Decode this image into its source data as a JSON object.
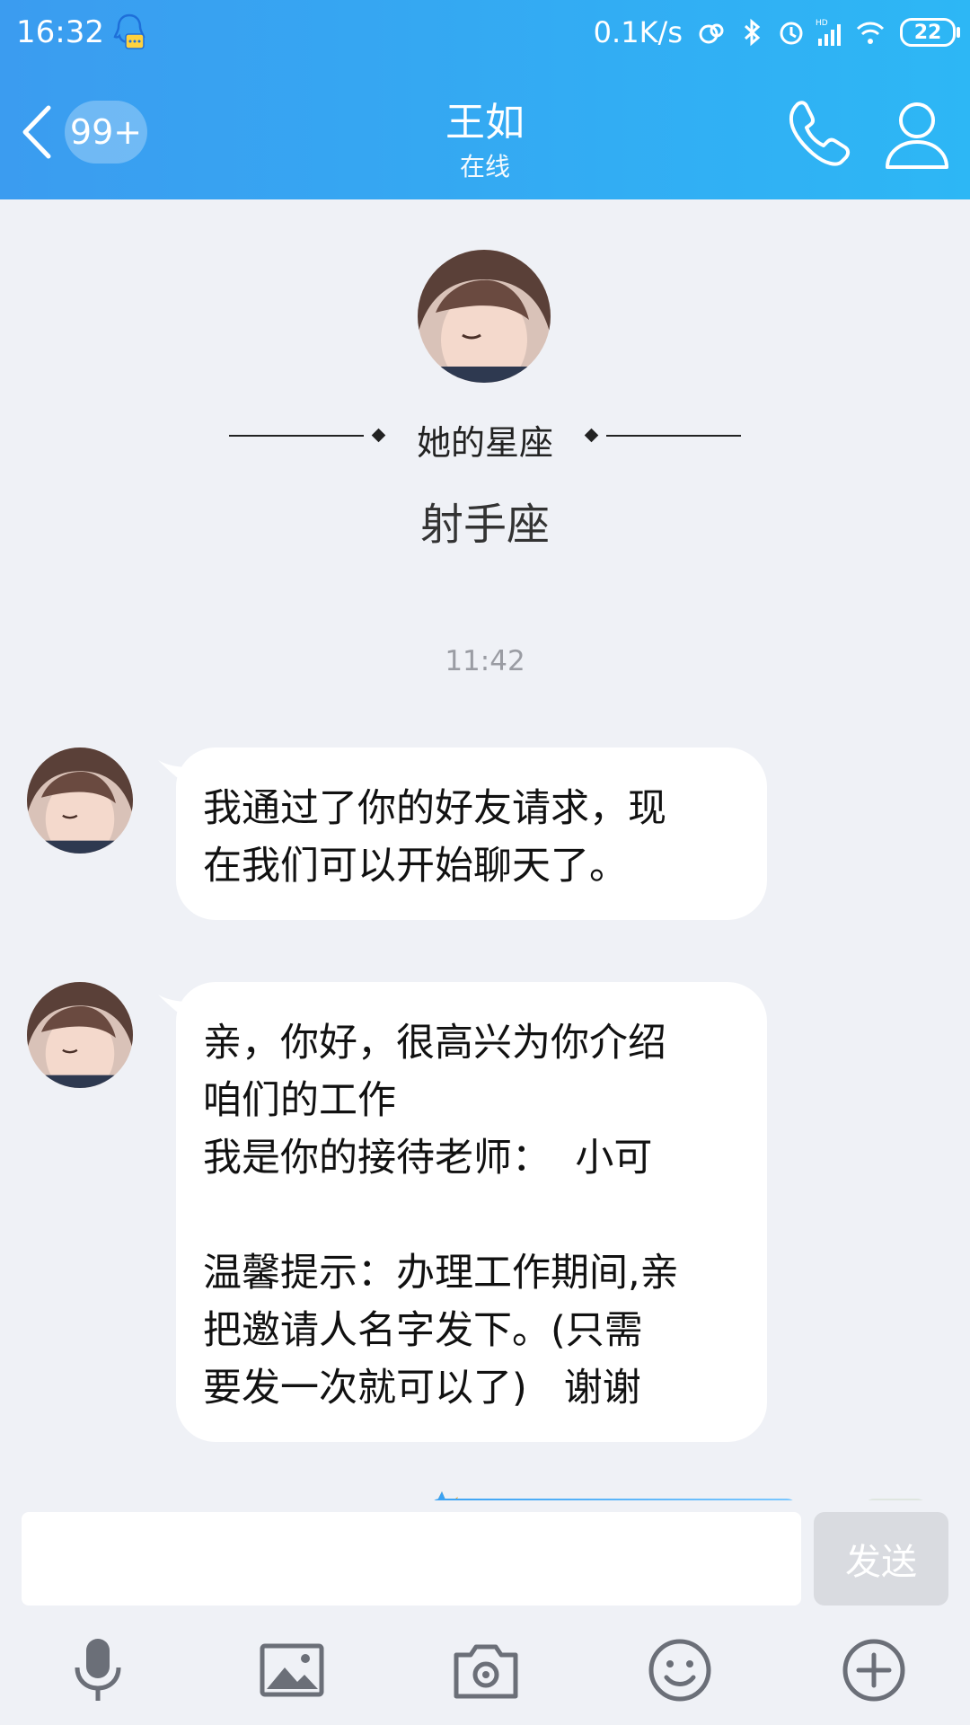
{
  "status_bar": {
    "time": "16:32",
    "net_speed": "0.1K/s",
    "battery": "22",
    "icons": [
      "qq-notify-icon",
      "hd-volte-icon",
      "bluetooth-icon",
      "alarm-icon",
      "signal-icon",
      "wifi-icon",
      "battery-icon"
    ]
  },
  "header": {
    "unread_count": "99+",
    "contact_name": "王如",
    "contact_status": "在线",
    "accent": "#2db7f5"
  },
  "intro": {
    "sign_title": "她的星座",
    "sign_value": "射手座"
  },
  "timestamp": "11:42",
  "messages": [
    {
      "text": "我通过了你的好友请求，现\n在我们可以开始聊天了。"
    },
    {
      "text": "亲，你好，很高兴为你介绍\n咱们的工作\n我是你的接待老师：  小可\n\n温馨提示：办理工作期间,亲\n把邀请人名字发下。(只需\n要发一次就可以了)   谢谢"
    }
  ],
  "composer": {
    "input_value": "",
    "send_label": "发送"
  },
  "toolbar": [
    "microphone-icon",
    "image-icon",
    "camera-icon",
    "emoji-icon",
    "plus-icon"
  ]
}
